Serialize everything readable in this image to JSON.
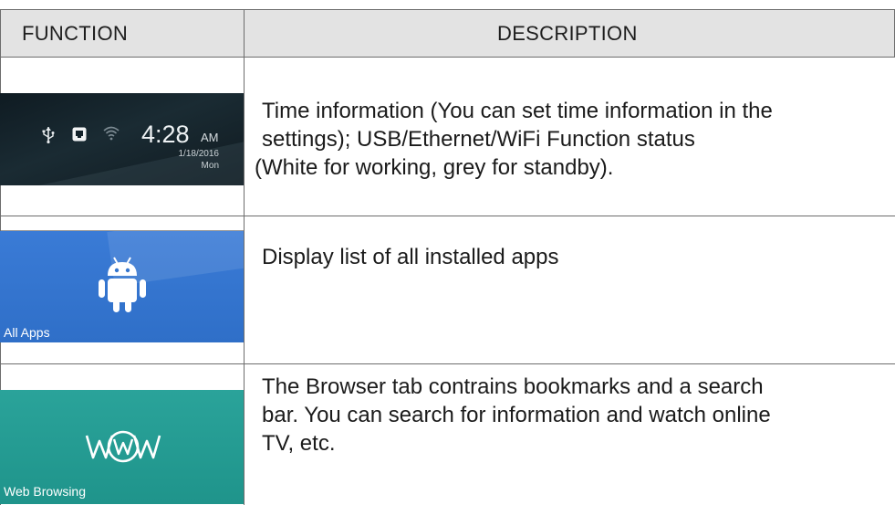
{
  "table": {
    "header": {
      "function": "FUNCTION",
      "description": "DESCRIPTION"
    },
    "rows": [
      {
        "status_bar": {
          "time": "4:28",
          "ampm": "AM",
          "date": "1/18/2016",
          "day": "Mon",
          "icons": [
            "usb-icon",
            "ethernet-icon",
            "wifi-icon"
          ]
        },
        "description_lines": [
          "Time information (You can set time information in the",
          "settings); USB/Ethernet/WiFi Function status",
          "(White for working, grey for standby)."
        ]
      },
      {
        "tile": {
          "label": "All Apps",
          "icon": "android-icon",
          "color": "#3476cf"
        },
        "description_lines": [
          "Display list of all installed apps"
        ]
      },
      {
        "tile": {
          "label": "Web Browsing",
          "icon": "www-icon",
          "color": "#249c93"
        },
        "description_lines": [
          "The Browser tab contrains bookmarks and a search",
          "bar. You can search for information and watch online",
          "TV, etc."
        ]
      }
    ]
  }
}
